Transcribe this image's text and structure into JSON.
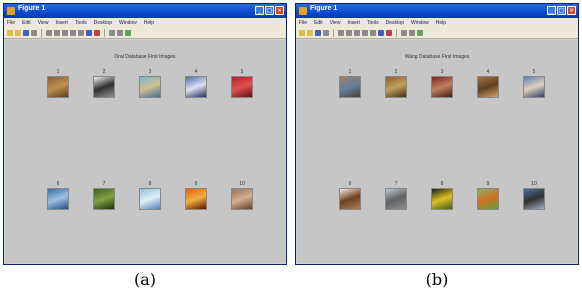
{
  "panels": [
    {
      "id": "a",
      "window_title": "Figure 1",
      "menu": [
        "File",
        "Edit",
        "View",
        "Insert",
        "Tools",
        "Desktop",
        "Window",
        "Help"
      ],
      "figure_title": "Oral Database First Images",
      "images": [
        {
          "num": "1",
          "colors": [
            "#8a6030",
            "#c09050",
            "#5a4020"
          ]
        },
        {
          "num": "2",
          "colors": [
            "#f0f0f0",
            "#303030",
            "#909090"
          ]
        },
        {
          "num": "3",
          "colors": [
            "#80b0d0",
            "#d0c090",
            "#407090"
          ]
        },
        {
          "num": "4",
          "colors": [
            "#5070b0",
            "#e0e0f0",
            "#203060"
          ]
        },
        {
          "num": "5",
          "colors": [
            "#b02020",
            "#e05050",
            "#601010"
          ]
        },
        {
          "num": "6",
          "colors": [
            "#3070b0",
            "#a0c0e0",
            "#205080"
          ]
        },
        {
          "num": "7",
          "colors": [
            "#406020",
            "#80a040",
            "#203010"
          ]
        },
        {
          "num": "8",
          "colors": [
            "#90c0e0",
            "#e0f0f8",
            "#5080b0"
          ]
        },
        {
          "num": "9",
          "colors": [
            "#e06010",
            "#f0b040",
            "#601000"
          ]
        },
        {
          "num": "10",
          "colors": [
            "#a07050",
            "#d0b090",
            "#604030"
          ]
        }
      ],
      "caption": "(a)"
    },
    {
      "id": "b",
      "window_title": "Figure 1",
      "menu": [
        "File",
        "Edit",
        "View",
        "Insert",
        "Tools",
        "Desktop",
        "Window",
        "Help"
      ],
      "figure_title": "Wang Database First Images",
      "images": [
        {
          "num": "1",
          "colors": [
            "#a08060",
            "#6080a0",
            "#504030"
          ]
        },
        {
          "num": "2",
          "colors": [
            "#906020",
            "#c0a060",
            "#403010"
          ]
        },
        {
          "num": "3",
          "colors": [
            "#802020",
            "#c08060",
            "#402010"
          ]
        },
        {
          "num": "4",
          "colors": [
            "#a07040",
            "#604020",
            "#d0a070"
          ]
        },
        {
          "num": "5",
          "colors": [
            "#6080b0",
            "#e0d0c0",
            "#304060"
          ]
        },
        {
          "num": "6",
          "colors": [
            "#f0e8e0",
            "#704020",
            "#a08060"
          ]
        },
        {
          "num": "7",
          "colors": [
            "#c0c8d0",
            "#606060",
            "#909090"
          ]
        },
        {
          "num": "8",
          "colors": [
            "#102010",
            "#e0c020",
            "#406020"
          ]
        },
        {
          "num": "9",
          "colors": [
            "#90b060",
            "#d07020",
            "#60a040"
          ]
        },
        {
          "num": "10",
          "colors": [
            "#5070a0",
            "#303030",
            "#a0b0c0"
          ]
        }
      ],
      "caption": "(b)"
    }
  ]
}
